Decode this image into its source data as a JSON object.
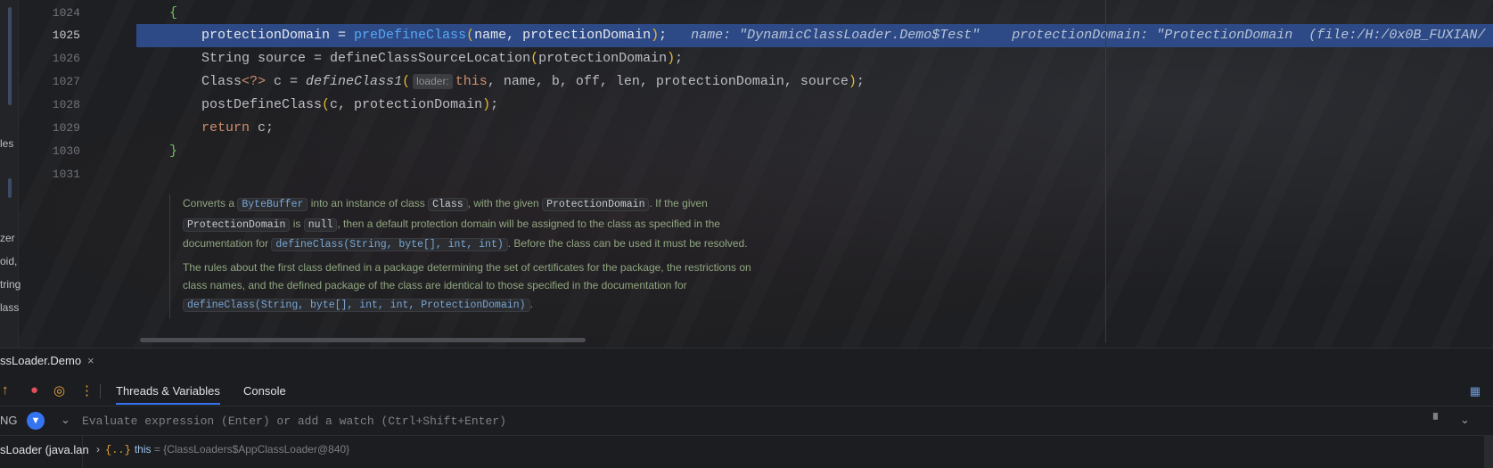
{
  "editor": {
    "left_strip": [
      "les",
      "zer",
      "oid,",
      "tring",
      "lass"
    ],
    "lines": [
      {
        "n": "1024"
      },
      {
        "n": "1025"
      },
      {
        "n": "1026"
      },
      {
        "n": "1027"
      },
      {
        "n": "1028"
      },
      {
        "n": "1029"
      },
      {
        "n": "1030"
      },
      {
        "n": "1031"
      }
    ],
    "code": {
      "l1024_brace": "{",
      "l1025_a": "protectionDomain = ",
      "l1025_fn": "preDefineClass",
      "l1025_b": "name, protectionDomain",
      "l1025_c": ";",
      "l1025_hint1": "name: \"DynamicClassLoader.Demo$Test\"",
      "l1025_hint2": "protectionDomain: \"ProtectionDomain  (file:/H:/0x0B_FUXIAN/",
      "l1026_a": "String source = ",
      "l1026_fn": "defineClassSourceLocation",
      "l1026_b": "protectionDomain",
      "l1027_a": "Class",
      "l1027_gen": "<?>",
      "l1027_b": " c = ",
      "l1027_fn": "defineClass1",
      "l1027_hint": "loader:",
      "l1027_kw": "this",
      "l1027_c": ", name, b, off, len, protectionDomain, source",
      "l1028_fn": "postDefineClass",
      "l1028_b": "c, protectionDomain",
      "l1029_kw": "return",
      "l1029_b": " c;",
      "l1030_brace": "}"
    },
    "doc": {
      "p1_1": "Converts a",
      "p1_c1": "ByteBuffer",
      "p1_2": "into an instance of class",
      "p1_c2": "Class",
      "p1_3": ", with the given",
      "p1_c3": "ProtectionDomain",
      "p1_4": ". If the given",
      "p1_c4": "ProtectionDomain",
      "p1_5": "is",
      "p1_c5": "null",
      "p1_6": ", then a default protection domain will be assigned to the class as specified in the documentation for",
      "p1_c6": "defineClass(String, byte[], int, int)",
      "p1_7": ". Before the class can be used it must be resolved.",
      "p2_1": "The rules about the first class defined in a package determining the set of certificates for the package, the restrictions on class names, and the defined package of the class are identical to those specified in the documentation for",
      "p2_c1": "defineClass(String, byte[], int, int, ProtectionDomain)",
      "p2_2": "."
    }
  },
  "debug": {
    "session_tab": "ssLoader.Demo",
    "session_close": "×",
    "tabs": [
      "Threads & Variables",
      "Console"
    ],
    "thread_label": "NG",
    "watch_placeholder": "Evaluate expression (Enter) or add a watch (Ctrl+Shift+Enter)",
    "frame": "sLoader (java.lan",
    "variable": {
      "icon": "{..}",
      "name": "this",
      "eq": " = ",
      "value": "{ClassLoaders$AppClassLoader@840}"
    }
  },
  "colors": {
    "exec_line": "#2d4a86",
    "accent": "#3574f0",
    "keyword": "#cf8e6d",
    "method": "#56a8f5",
    "doc_text": "#8fa67f"
  }
}
